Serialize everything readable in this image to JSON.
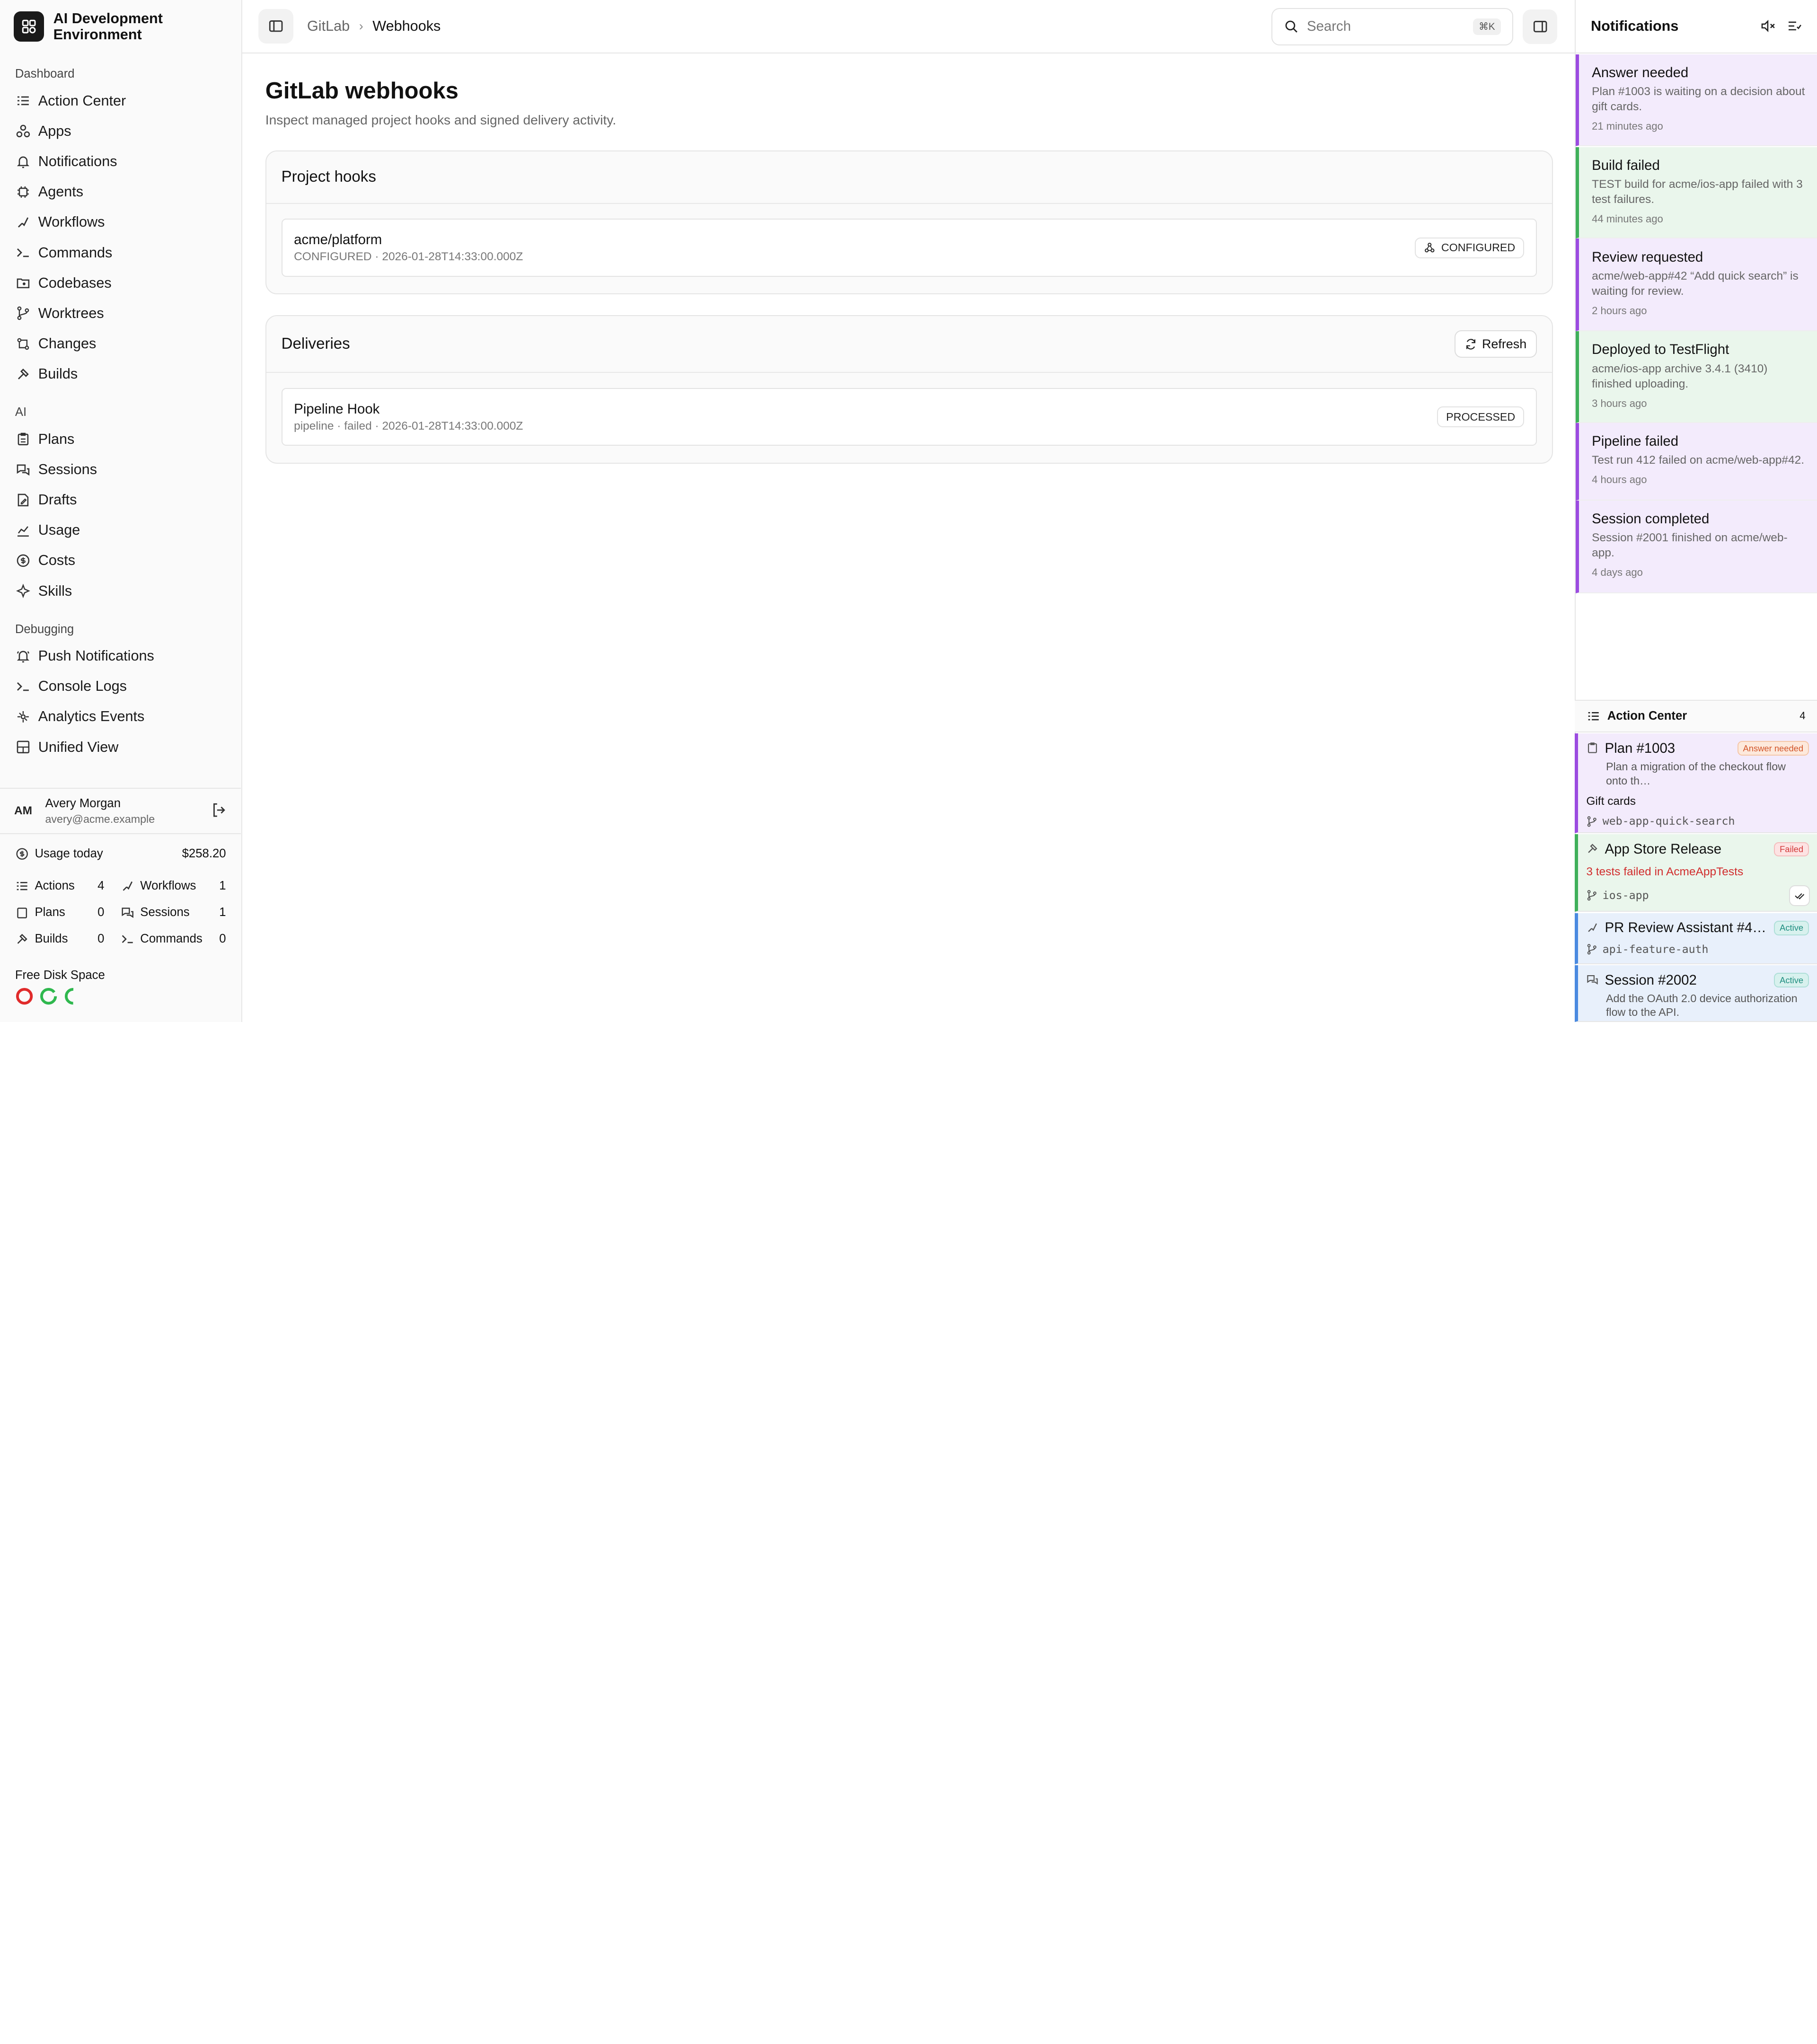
{
  "app": {
    "name": "AI Development Environment"
  },
  "sidebar": {
    "sections": [
      {
        "label": "Dashboard",
        "items": [
          "Action Center",
          "Apps",
          "Notifications",
          "Agents",
          "Workflows",
          "Commands",
          "Codebases",
          "Worktrees",
          "Changes",
          "Builds"
        ]
      },
      {
        "label": "AI",
        "items": [
          "Plans",
          "Sessions",
          "Drafts",
          "Usage",
          "Costs",
          "Skills"
        ]
      },
      {
        "label": "Debugging",
        "items": [
          "Push Notifications",
          "Console Logs",
          "Analytics Events",
          "Unified View"
        ]
      }
    ],
    "user": {
      "initials": "AM",
      "name": "Avery Morgan",
      "email": "avery@acme.example"
    },
    "usage": {
      "label": "Usage today",
      "value": "$258.20"
    },
    "stats": [
      {
        "label": "Actions",
        "value": "4"
      },
      {
        "label": "Workflows",
        "value": "1"
      },
      {
        "label": "Plans",
        "value": "0"
      },
      {
        "label": "Sessions",
        "value": "1"
      },
      {
        "label": "Builds",
        "value": "0"
      },
      {
        "label": "Commands",
        "value": "0"
      }
    ],
    "disk": {
      "label": "Free Disk Space",
      "colors": [
        "#e02b2b",
        "#2fb84e",
        "#2fb84e"
      ]
    }
  },
  "topbar": {
    "breadcrumb": [
      "GitLab",
      "Webhooks"
    ],
    "search_placeholder": "Search",
    "search_shortcut": "⌘K"
  },
  "main": {
    "title": "GitLab webhooks",
    "subtitle": "Inspect managed project hooks and signed delivery activity.",
    "hooks": {
      "heading": "Project hooks",
      "items": [
        {
          "name": "acme/platform",
          "meta": "CONFIGURED · 2026-01-28T14:33:00.000Z",
          "status": "CONFIGURED"
        }
      ]
    },
    "deliveries": {
      "heading": "Deliveries",
      "refresh_label": "Refresh",
      "items": [
        {
          "name": "Pipeline Hook",
          "meta": "pipeline · failed · 2026-01-28T14:33:00.000Z",
          "status": "PROCESSED"
        }
      ]
    }
  },
  "notifications": {
    "title": "Notifications",
    "items": [
      {
        "title": "Answer needed",
        "body": "Plan #1003 is waiting on a decision about gift cards.",
        "time": "21 minutes ago",
        "tone": "purple"
      },
      {
        "title": "Build failed",
        "body": "TEST build for acme/ios-app failed with 3 test failures.",
        "time": "44 minutes ago",
        "tone": "green"
      },
      {
        "title": "Review requested",
        "body": "acme/web-app#42 “Add quick search” is waiting for review.",
        "time": "2 hours ago",
        "tone": "purple"
      },
      {
        "title": "Deployed to TestFlight",
        "body": "acme/ios-app archive 3.4.1 (3410) finished uploading.",
        "time": "3 hours ago",
        "tone": "green"
      },
      {
        "title": "Pipeline failed",
        "body": "Test run 412 failed on acme/web-app#42.",
        "time": "4 hours ago",
        "tone": "purple"
      },
      {
        "title": "Session completed",
        "body": "Session #2001 finished on acme/web-app.",
        "time": "4 days ago",
        "tone": "purple"
      }
    ]
  },
  "action_center": {
    "title": "Action Center",
    "count": "4",
    "items": [
      {
        "title": "Plan #1003",
        "badge": "Answer needed",
        "desc": "Plan a migration of the checkout flow onto th…",
        "extra": "Gift cards",
        "branch": "web-app-quick-search"
      },
      {
        "title": "App Store Release",
        "badge": "Failed",
        "error": "3 tests failed in AcmeAppTests",
        "branch": "ios-app"
      },
      {
        "title": "PR Review Assistant #4…",
        "badge": "Active",
        "branch": "api-feature-auth"
      },
      {
        "title": "Session #2002",
        "badge": "Active",
        "desc": "Add the OAuth 2.0 device authorization flow to the API."
      }
    ]
  }
}
